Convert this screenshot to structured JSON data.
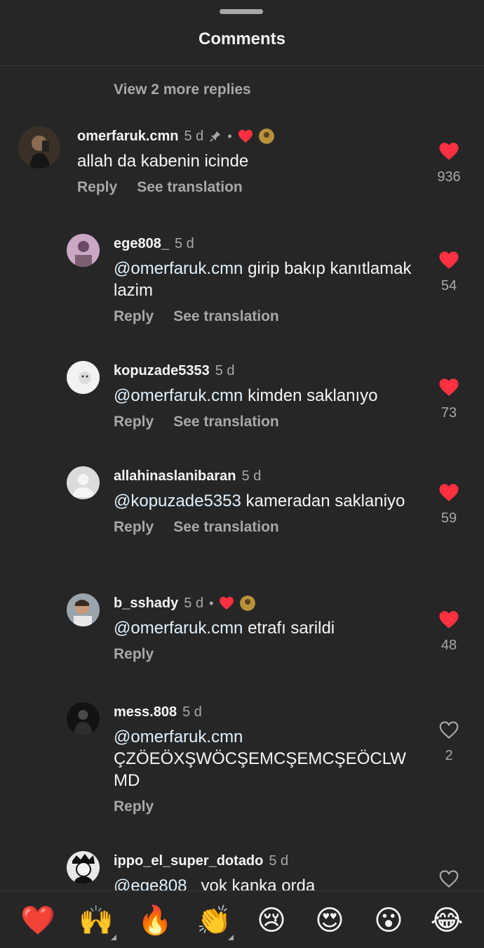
{
  "header": {
    "title": "Comments"
  },
  "thread": {
    "view_more": "View 2 more replies"
  },
  "comments": [
    {
      "username": "omerfaruk.cmn",
      "time": "5 d",
      "mention": "",
      "text": "allah da kabenin icinde",
      "reply_label": "Reply",
      "translate_label": "See translation",
      "likes": "936",
      "liked": true
    },
    {
      "username": "ege808_",
      "time": "5 d",
      "mention": "@omerfaruk.cmn",
      "text": " girip bakıp kanıtlamak lazim",
      "reply_label": "Reply",
      "translate_label": "See translation",
      "likes": "54",
      "liked": true
    },
    {
      "username": "kopuzade5353",
      "time": "5 d",
      "mention": "@omerfaruk.cmn",
      "text": " kimden saklanıyo",
      "reply_label": "Reply",
      "translate_label": "See translation",
      "likes": "73",
      "liked": true
    },
    {
      "username": "allahinaslanibaran",
      "time": "5 d",
      "mention": "@kopuzade5353",
      "text": " kameradan saklaniyo",
      "reply_label": "Reply",
      "translate_label": "See translation",
      "likes": "59",
      "liked": true
    },
    {
      "username": "b_sshady",
      "time": "5 d",
      "mention": "@omerfaruk.cmn",
      "text": " etrafı sarildi",
      "reply_label": "Reply",
      "likes": "48",
      "liked": true
    },
    {
      "username": "mess.808",
      "time": "5 d",
      "mention": "@omerfaruk.cmn",
      "text": " ÇZÖEÖXŞWÖCŞEMCŞEMCŞEÖCLWMD",
      "reply_label": "Reply",
      "likes": "2",
      "liked": false
    },
    {
      "username": "ippo_el_super_dotado",
      "time": "5 d",
      "mention": "@ege808_",
      "text": " yok kanka orda",
      "liked": false
    }
  ],
  "reactions": [
    "❤️",
    "🙌",
    "🔥",
    "👏",
    "😢",
    "😍",
    "😮",
    "😂"
  ],
  "colors": {
    "background": "#262626",
    "like_red": "#ff3040",
    "muted": "#a8a8a8",
    "mention": "#e0f1ff"
  }
}
